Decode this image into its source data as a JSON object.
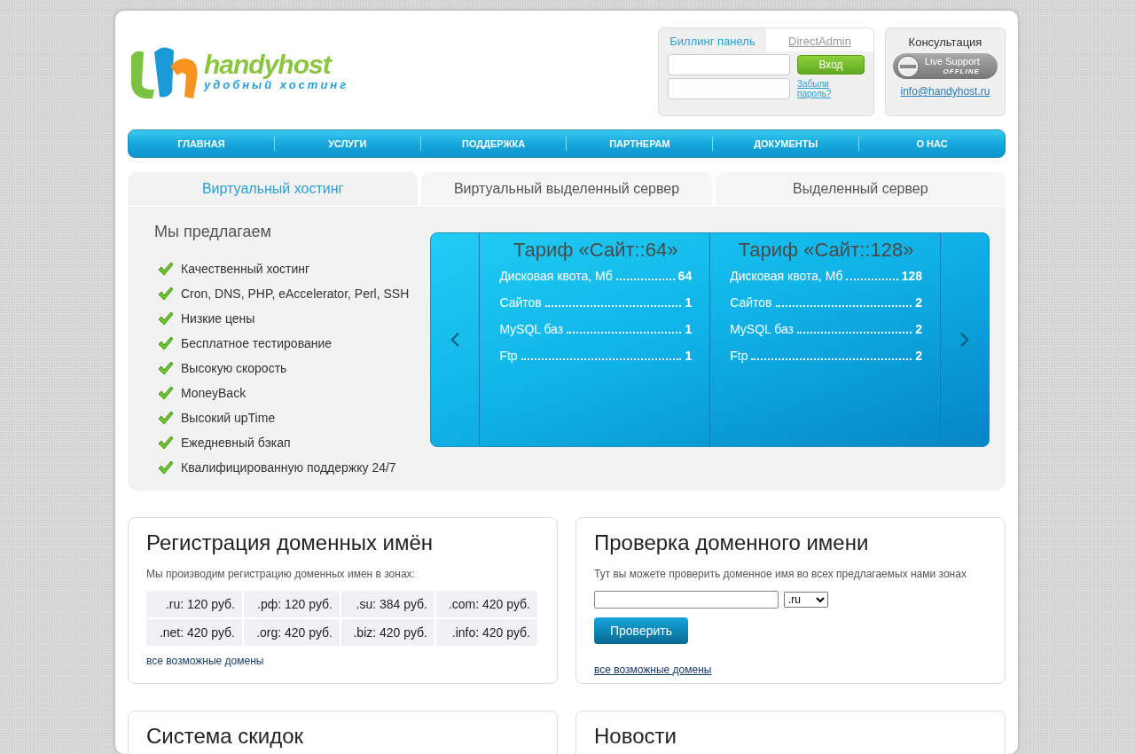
{
  "header": {
    "logo": {
      "name": "handyhost",
      "tagline": "удобный хостинг"
    },
    "login": {
      "tabs": [
        {
          "label": "Биллинг панель",
          "selected": true
        },
        {
          "label": "DirectAdmin",
          "selected": false
        }
      ],
      "button": "Вход",
      "forgot_link": "Забыли пароль?"
    },
    "consult": {
      "title": "Консультация",
      "badge_main": "Live Support",
      "badge_status": "OFFLINE",
      "email": "info@handyhost.ru"
    }
  },
  "nav": [
    "ГЛАВНАЯ",
    "УСЛУГИ",
    "ПОДДЕРЖКА",
    "ПАРТНЕРАМ",
    "ДОКУМЕНТЫ",
    "О НАС"
  ],
  "hosting_tabs": [
    {
      "label": "Виртуальный хостинг",
      "selected": true
    },
    {
      "label": "Виртуальный выделенный сервер",
      "selected": false
    },
    {
      "label": "Выделенный сервер",
      "selected": false
    }
  ],
  "offer": {
    "title": "Мы предлагаем",
    "items": [
      "Качественный хостинг",
      "Cron, DNS, PHP, eAccelerator, Perl, SSH",
      "Низкие цены",
      "Бесплатное тестирование",
      "Высокую скорость",
      "MoneyBack",
      "Высокий upTime",
      "Ежедневный бэкап",
      "Квалифицированную поддержку 24/7"
    ]
  },
  "tariffs": [
    {
      "title": "Тариф «Сайт::64»",
      "rows": [
        {
          "label": "Дисковая квота, Мб",
          "value": "64"
        },
        {
          "label": "Сайтов",
          "value": "1"
        },
        {
          "label": "MySQL баз",
          "value": "1"
        },
        {
          "label": "Ftp",
          "value": "1"
        }
      ]
    },
    {
      "title": "Тариф «Сайт::128»",
      "rows": [
        {
          "label": "Дисковая квота, Мб",
          "value": "128"
        },
        {
          "label": "Сайтов",
          "value": "2"
        },
        {
          "label": "MySQL баз",
          "value": "2"
        },
        {
          "label": "Ftp",
          "value": "2"
        }
      ]
    }
  ],
  "domains": {
    "title": "Регистрация доменных имён",
    "intro": "Мы производим регистрацию доменных имен в зонах:",
    "prices": [
      {
        "zone": ".ru:",
        "price": "120 руб."
      },
      {
        "zone": ".рф:",
        "price": "120 руб."
      },
      {
        "zone": ".su:",
        "price": "384 руб."
      },
      {
        "zone": ".com:",
        "price": "420 руб."
      },
      {
        "zone": ".net:",
        "price": "420 руб."
      },
      {
        "zone": ".org:",
        "price": "420 руб."
      },
      {
        "zone": ".biz:",
        "price": "420 руб."
      },
      {
        "zone": ".info:",
        "price": "420 руб."
      }
    ],
    "link": "все возможные домены"
  },
  "check": {
    "title": "Проверка доменного имени",
    "intro": "Тут вы можете проверить доменное имя во всех предлагаемых нами зонах",
    "zone": ".ru",
    "button": "Проверить",
    "link": "все возможные домены"
  },
  "bottom": [
    {
      "title": "Система скидок"
    },
    {
      "title": "Новости"
    }
  ]
}
